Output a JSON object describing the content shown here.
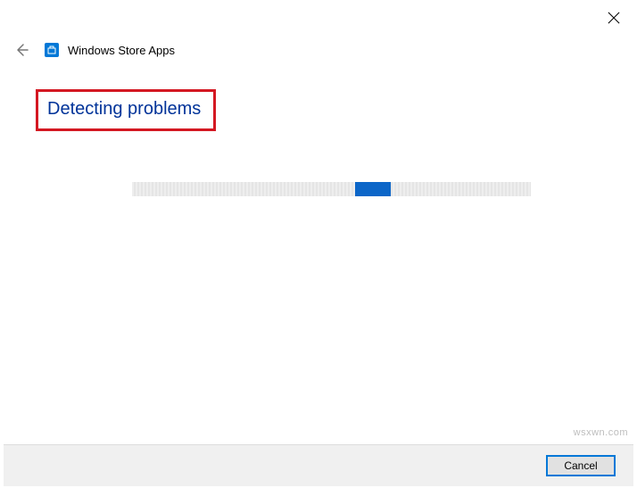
{
  "window": {
    "close_aria": "Close"
  },
  "header": {
    "back_aria": "Back",
    "icon_name": "store-icon",
    "title": "Windows Store Apps"
  },
  "status": {
    "text": "Detecting problems"
  },
  "progress": {
    "indeterminate": true
  },
  "footer": {
    "cancel_label": "Cancel"
  },
  "watermark": "wsxwn.com"
}
